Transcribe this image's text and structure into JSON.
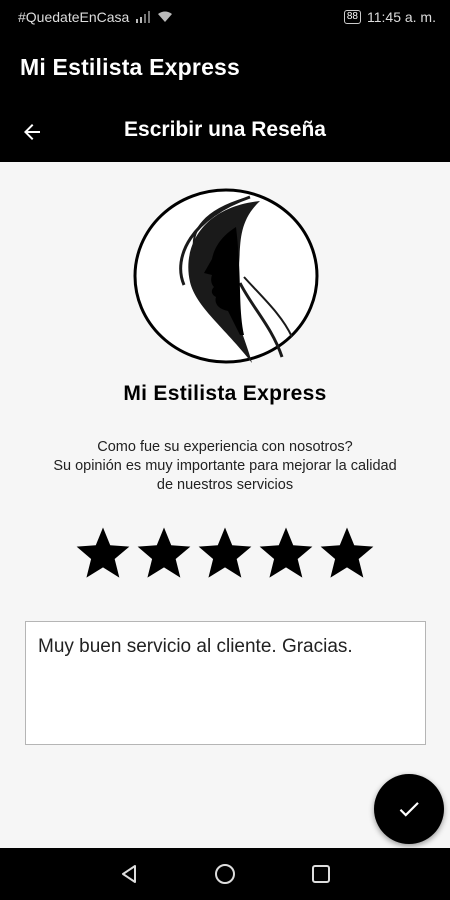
{
  "status_bar": {
    "left_text": "#QuedateEnCasa",
    "battery": "88",
    "time": "11:45 a. m."
  },
  "app_bar": {
    "app_title": "Mi Estilista Express",
    "screen_title": "Escribir una Reseña"
  },
  "brand": {
    "name": "Mi Estilista Express"
  },
  "prompt": {
    "line1": "Como fue su experiencia con nosotros?",
    "line2": "Su opinión es muy importante para mejorar la calidad",
    "line3": "de nuestros servicios"
  },
  "rating": {
    "value": 5,
    "max": 5
  },
  "review": {
    "text": "Muy buen servicio al cliente. Gracias."
  },
  "icons": {
    "back": "arrow-left-icon",
    "submit": "check-icon",
    "star": "star-icon",
    "nav_back": "triangle-back-icon",
    "nav_home": "circle-home-icon",
    "nav_recents": "square-recents-icon"
  },
  "colors": {
    "bars": "#000000",
    "background": "#f6f6f6",
    "star": "#000000"
  }
}
